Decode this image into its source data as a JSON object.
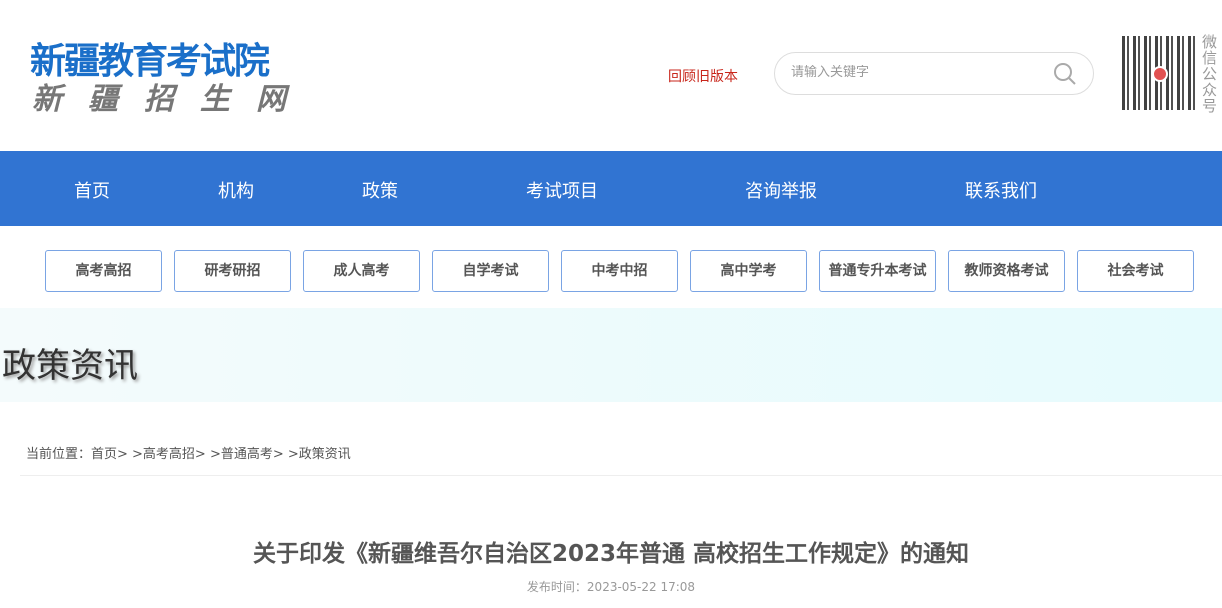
{
  "header": {
    "logo_main": "新疆教育考试院",
    "logo_sub": "新疆招生网",
    "old_version": "回顾旧版本",
    "search_placeholder": "请输入关键字",
    "qr_label": "微信公众号"
  },
  "nav": [
    "首页",
    "机构",
    "政策",
    "考试项目",
    "咨询举报",
    "联系我们"
  ],
  "categories": [
    "高考高招",
    "研考研招",
    "成人高考",
    "自学考试",
    "中考中招",
    "高中学考",
    "普通专升本考试",
    "教师资格考试",
    "社会考试"
  ],
  "banner": {
    "title": "政策资讯"
  },
  "breadcrumb": "当前位置：首页> >高考高招> >普通高考> >政策资讯",
  "article": {
    "title": "关于印发《新疆维吾尔自治区2023年普通 高校招生工作规定》的通知",
    "date": "发布时间：2023-05-22 17:08"
  }
}
